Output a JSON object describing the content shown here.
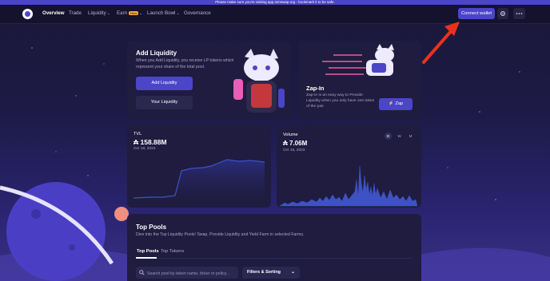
{
  "announcement": "Please make sure you're visiting app.minswap.org - bookmark it to be safe.",
  "nav": {
    "items": [
      {
        "label": "Overview",
        "active": true
      },
      {
        "label": "Trade"
      },
      {
        "label": "Liquidity"
      },
      {
        "label": "Earn",
        "badge": "New"
      },
      {
        "label": "Launch Bowl"
      },
      {
        "label": "Governance"
      }
    ],
    "connect_wallet": "Connect wallet",
    "settings_icon": "gear-icon",
    "more_icon": "more-dots-icon"
  },
  "add_liquidity": {
    "title": "Add Liquidity",
    "description": "When you Add Liquidity, you receive LP tokens which represent your share of the total pool.",
    "add_button": "Add Liquidity",
    "your_button": "Your Liquidity"
  },
  "zap_in": {
    "title": "Zap-In",
    "description": "Zap-In is an easy way to Provide Liquidity when you only have one token of the pair.",
    "zap_button": "Zap"
  },
  "tvl": {
    "label": "TVL",
    "value": "₳ 158.88M",
    "date": "Oct 18, 2023"
  },
  "volume": {
    "label": "Volume",
    "value": "₳ 7.06M",
    "date": "Oct 18, 2023",
    "toggles": [
      "D",
      "W",
      "M"
    ],
    "active_toggle": "D"
  },
  "top_pools": {
    "title": "Top Pools",
    "description": "Dive into the Top Liquidity Pools! Swap, Provide Liquidity and Yield Farm in selected Farms.",
    "tabs": [
      {
        "label": "Top Pools",
        "active": true
      },
      {
        "label": "Top Tokens"
      }
    ],
    "search_placeholder": "Search pool by token name, ticker or policy...",
    "filters": "Filters & Sorting"
  },
  "colors": {
    "accent": "#4b45c9",
    "arrow": "#e8321e",
    "chart_line": "#3f52c4"
  }
}
